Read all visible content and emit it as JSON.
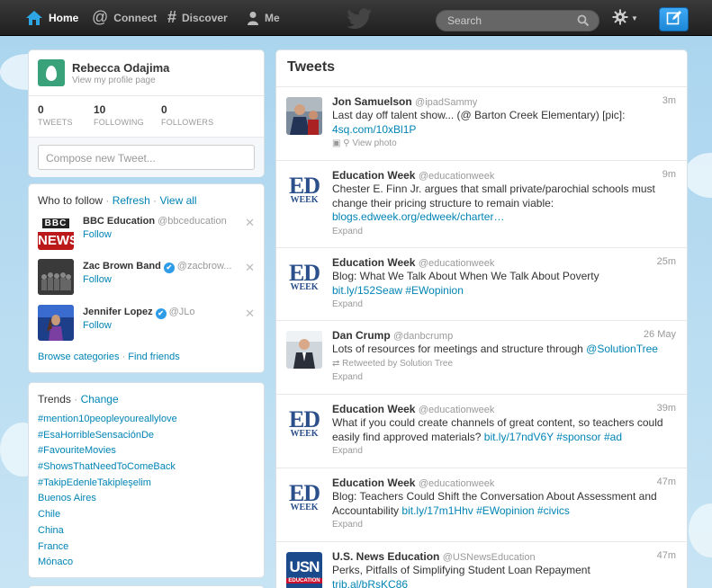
{
  "nav": {
    "home": "Home",
    "connect": "Connect",
    "discover": "Discover",
    "me": "Me",
    "search_placeholder": "Search"
  },
  "profile": {
    "name": "Rebecca Odajima",
    "view_link": "View my profile page",
    "tweets_count": "0",
    "tweets_label": "TWEETS",
    "following_count": "10",
    "following_label": "FOLLOWING",
    "followers_count": "0",
    "followers_label": "FOLLOWERS",
    "compose_placeholder": "Compose new Tweet..."
  },
  "who_to_follow": {
    "title": "Who to follow",
    "refresh": "Refresh",
    "view_all": "View all",
    "items": [
      {
        "name": "BBC Education",
        "handle": "@bbceducation",
        "follow": "Follow",
        "verified": false
      },
      {
        "name": "Zac Brown Band",
        "handle": "@zacbrow...",
        "follow": "Follow",
        "verified": true
      },
      {
        "name": "Jennifer Lopez",
        "handle": "@JLo",
        "follow": "Follow",
        "verified": true
      }
    ],
    "browse": "Browse categories",
    "find_friends": "Find friends"
  },
  "trends": {
    "title": "Trends",
    "change": "Change",
    "items": [
      "#mention10peopleyoureallylove",
      "#EsaHorribleSensaciónDe",
      "#FavouriteMovies",
      "#ShowsThatNeedToComeBack",
      "#TakipEdenleTakipleşelim",
      "Buenos Aires",
      "Chile",
      "China",
      "France",
      "Mónaco"
    ]
  },
  "tweets": {
    "title": "Tweets",
    "items": [
      {
        "name": "Jon Samuelson",
        "handle": "@ipadSammy",
        "time": "3m",
        "text": "Last day off talent show... (@ Barton Creek Elementary) [pic]:",
        "link": "4sq.com/10xBl1P",
        "action": "View photo"
      },
      {
        "name": "Education Week",
        "handle": "@educationweek",
        "time": "9m",
        "text": "Chester E. Finn Jr. argues that small private/parochial schools must change their pricing structure to remain viable:",
        "link": "blogs.edweek.org/edweek/charter…",
        "action": "Expand"
      },
      {
        "name": "Education Week",
        "handle": "@educationweek",
        "time": "25m",
        "text": "Blog: What We Talk About When We Talk About Poverty",
        "link": "bit.ly/152Seaw #EWopinion",
        "action": "Expand"
      },
      {
        "name": "Dan Crump",
        "handle": "@danbcrump",
        "time": "26 May",
        "text": "Lots of resources for meetings and structure through",
        "link": "@SolutionTree",
        "retweeted": "Retweeted by Solution Tree",
        "action": "Expand"
      },
      {
        "name": "Education Week",
        "handle": "@educationweek",
        "time": "39m",
        "text": "What if you could create channels of great content, so teachers could easily find approved materials?",
        "link": "bit.ly/17ndV6Y #sponsor #ad",
        "action": "Expand"
      },
      {
        "name": "Education Week",
        "handle": "@educationweek",
        "time": "47m",
        "text": "Blog: Teachers Could Shift the Conversation About Assessment and Accountability",
        "link": "bit.ly/17m1Hhv #EWopinion #civics",
        "action": "Expand"
      },
      {
        "name": "U.S. News Education",
        "handle": "@USNewsEducation",
        "time": "47m",
        "text": "Perks, Pitfalls of Simplifying Student Loan Repayment",
        "link": "trib.al/bRsKC86",
        "action": ""
      }
    ]
  },
  "logos": {
    "bbc_top": "BBC",
    "bbc_bottom": "NEWS",
    "ew_top": "ED",
    "ew_bottom": "WEEK",
    "usn_top": "USN",
    "usn_bottom": "EDUCATION"
  },
  "colors": {
    "link": "#0084b4",
    "topbar": "#2a2a2a",
    "compose_button": "#2b95e9",
    "background": "#c0deed"
  }
}
